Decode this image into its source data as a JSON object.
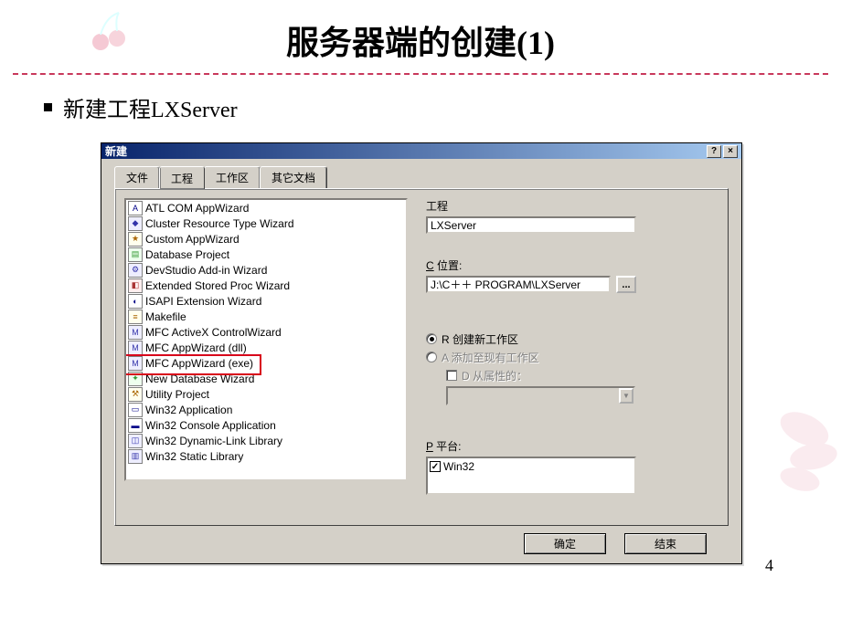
{
  "slide": {
    "title": "服务器端的创建(1)",
    "bullet": "新建工程LXServer",
    "page_number": "4"
  },
  "dialog": {
    "title": "新建",
    "help_btn": "?",
    "close_btn": "×",
    "tabs": [
      "文件",
      "工程",
      "工作区",
      "其它文档"
    ],
    "active_tab_index": 1,
    "project_types": [
      "ATL COM AppWizard",
      "Cluster Resource Type Wizard",
      "Custom AppWizard",
      "Database Project",
      "DevStudio Add-in Wizard",
      "Extended Stored Proc Wizard",
      "ISAPI Extension Wizard",
      "Makefile",
      "MFC ActiveX ControlWizard",
      "MFC AppWizard (dll)",
      "MFC AppWizard (exe)",
      "New Database Wizard",
      "Utility Project",
      "Win32 Application",
      "Win32 Console Application",
      "Win32 Dynamic-Link Library",
      "Win32 Static Library"
    ],
    "selected_type_index": 10,
    "right": {
      "project_label": "工程",
      "project_name": "LXServer",
      "location_label_prefix": "C",
      "location_label_rest": " 位置:",
      "location_value": "J:\\C＋＋ PROGRAM\\LXServer",
      "browse": "...",
      "radio_create_prefix": "R",
      "radio_create_rest": " 创建新工作区",
      "radio_add_prefix": "A",
      "radio_add_rest": " 添加至现有工作区",
      "check_dep_prefix": "D",
      "check_dep_rest": " 从属性的：",
      "platform_label_prefix": "P",
      "platform_label_rest": " 平台:",
      "platform_item": "Win32"
    },
    "buttons": {
      "ok": "确定",
      "cancel": "结束"
    }
  }
}
